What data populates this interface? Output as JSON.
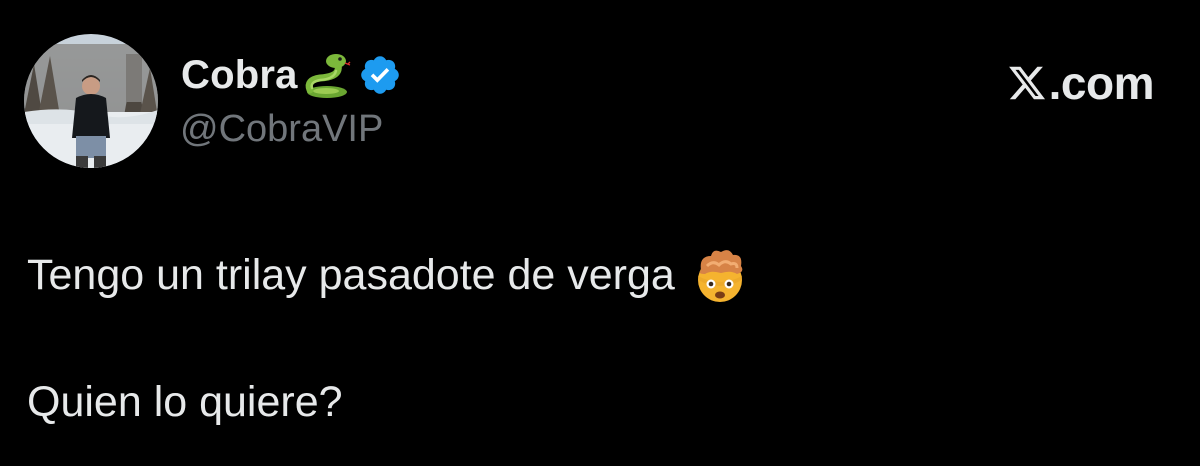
{
  "tweet": {
    "author": {
      "display_name": "Cobra",
      "handle": "@CobraVIP",
      "name_emoji": "snake-emoji",
      "verified": true,
      "verified_color": "#1d9bf0"
    },
    "brand": {
      "logo": "x-logo-icon",
      "text": ".com"
    },
    "text_lines": [
      "Tengo un trilay pasadote de verga",
      "Quien lo quiere?"
    ],
    "line1_emoji": "exploding-head-emoji"
  },
  "colors": {
    "background": "#000000",
    "primary_text": "#e7e9ea",
    "secondary_text": "#71767b"
  }
}
